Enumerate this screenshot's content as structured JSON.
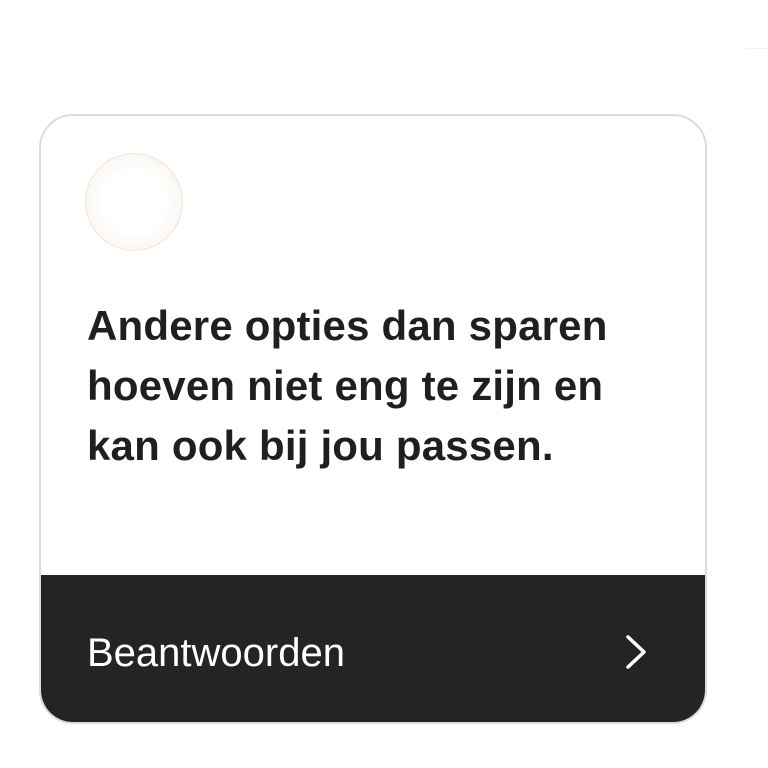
{
  "card": {
    "message": "Andere opties dan sparen hoeven niet eng te zijn en kan ook bij jou passen.",
    "reply_label": "Beantwoorden",
    "avatar_icon": "avatar-image",
    "chevron_icon": "chevron-right-icon"
  },
  "colors": {
    "card_border": "#dcdcdc",
    "reply_bar_background": "#242424",
    "message_text": "#1f1f1f",
    "reply_text": "#ffffff"
  }
}
